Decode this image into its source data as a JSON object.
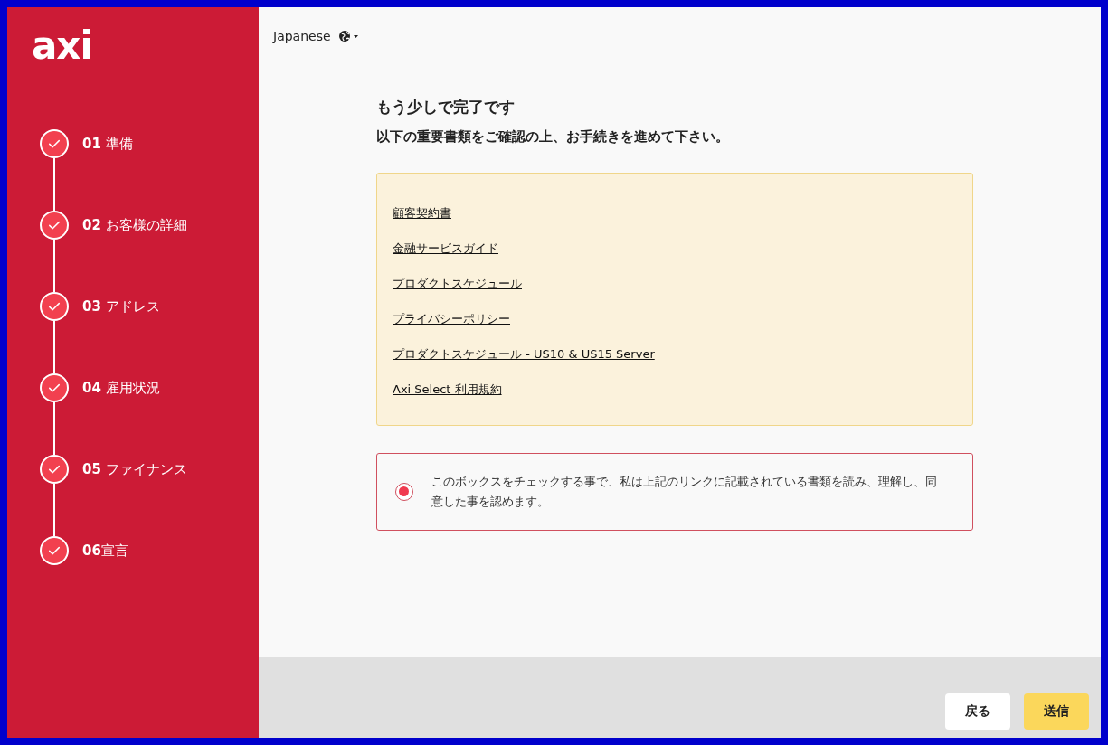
{
  "logo": "axi",
  "steps": [
    {
      "number": "01",
      "label": "準備",
      "completed": true
    },
    {
      "number": "02",
      "label": "お客様の詳細",
      "completed": true
    },
    {
      "number": "03",
      "label": "アドレス",
      "completed": true
    },
    {
      "number": "04",
      "label": "雇用状況",
      "completed": true
    },
    {
      "number": "05",
      "label": "ファイナンス",
      "completed": true
    },
    {
      "number": "06",
      "label": "宣言",
      "completed": true,
      "tight": true
    }
  ],
  "language": "Japanese",
  "heading": "もう少しで完了です",
  "subheading": "以下の重要書類をご確認の上、お手続きを進めて下さい。",
  "documents": [
    "顧客契約書",
    "金融サービスガイド",
    "プロダクトスケジュール",
    "プライバシーポリシー",
    "プロダクトスケジュール - US10 & US15 Server",
    "Axi Select 利用規約"
  ],
  "agreement": {
    "text": "このボックスをチェックする事で、私は上記のリンクに記載されている書類を読み、理解し、同意した事を認めます。",
    "checked": true
  },
  "buttons": [
    {
      "label": "戻る",
      "kind": "secondary"
    },
    {
      "label": "送信",
      "kind": "primary"
    }
  ]
}
